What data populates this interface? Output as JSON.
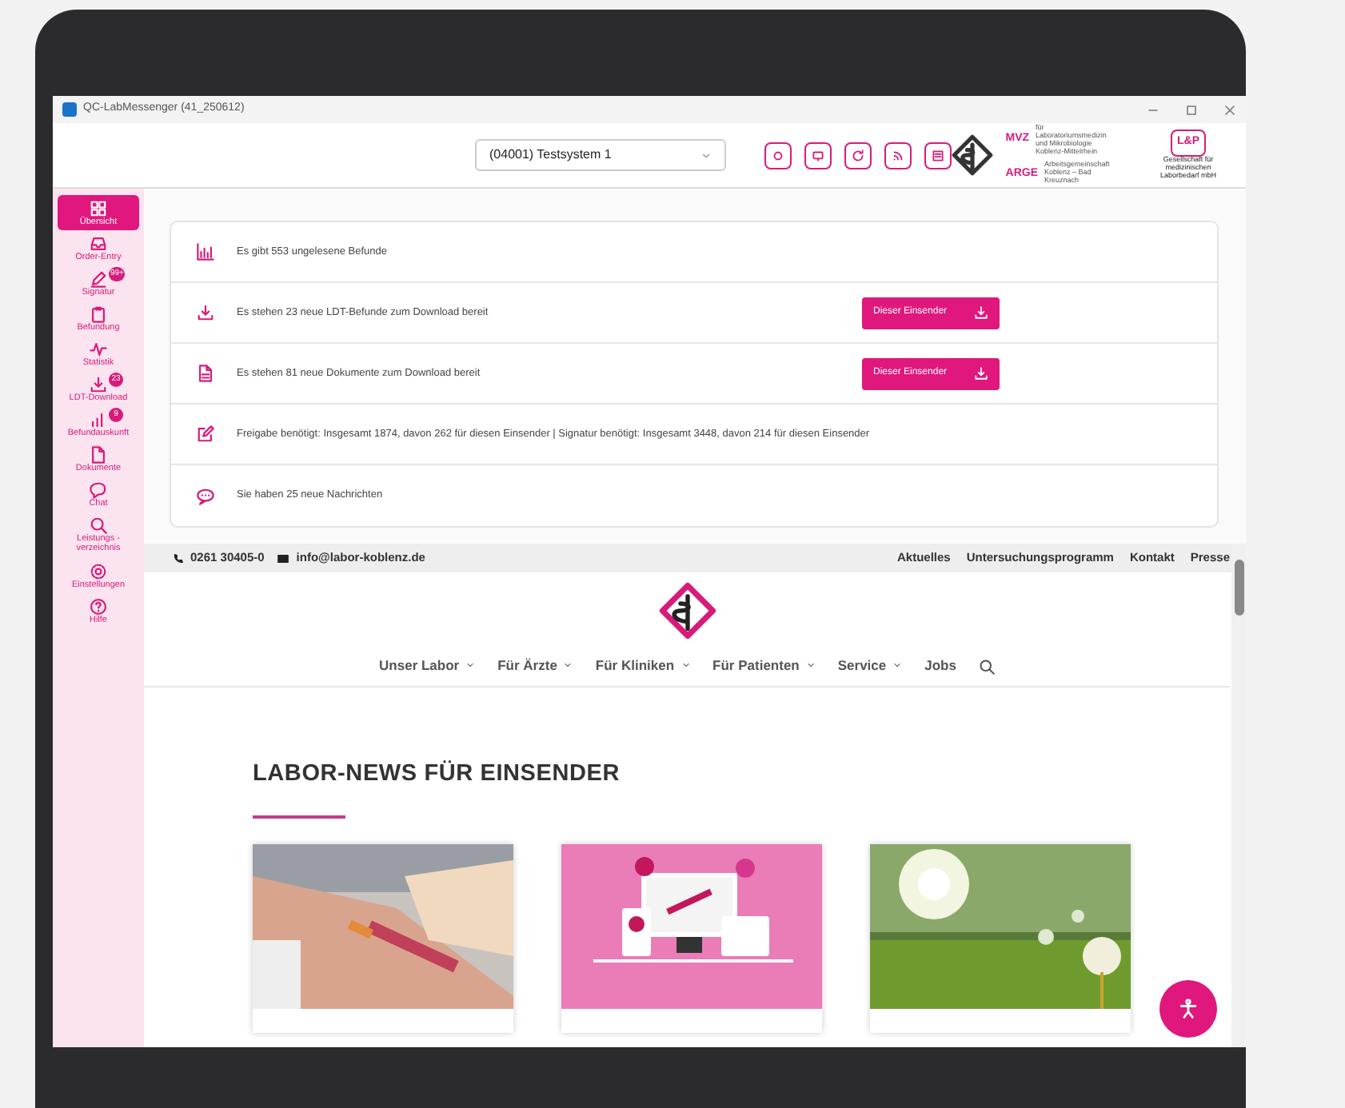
{
  "window": {
    "title": "QC-LabMessenger (41_250612)"
  },
  "header": {
    "system_select": "(04001) Testsystem 1",
    "logos": [
      {
        "title": "MVZ",
        "text": "für Laboratoriumsmedizin und Mikrobiologie Koblenz-Mittelrhein"
      },
      {
        "title": "ARGE",
        "text": "Arbeitsgemeinschaft Koblenz – Bad Kreuznach"
      },
      {
        "title": "L&P",
        "text": "Gesellschaft für medizinischen Laborbedarf mbH"
      }
    ]
  },
  "sidebar": {
    "items": [
      {
        "label": "Übersicht",
        "selected": true
      },
      {
        "label": "Order-Entry",
        "selected": false
      },
      {
        "label": "Signatur",
        "selected": false,
        "badge": "99+"
      },
      {
        "label": "Befundung",
        "selected": false
      },
      {
        "label": "Statistik",
        "selected": false
      },
      {
        "label": "LDT-Download",
        "selected": false,
        "badge": "23"
      },
      {
        "label": "Befundauskunft",
        "selected": false,
        "badge": "9"
      },
      {
        "label": "Dokumente",
        "selected": false
      },
      {
        "label": "Chat",
        "selected": false
      },
      {
        "label": "Leistungs - verzeichnis",
        "selected": false
      },
      {
        "label": "Einstellungen",
        "selected": false
      },
      {
        "label": "Hilfe",
        "selected": false
      }
    ]
  },
  "notifications": [
    {
      "kind": "chart",
      "text": "Es gibt 553 ungelesene Befunde"
    },
    {
      "kind": "download",
      "text": "Es stehen 23 neue LDT-Befunde zum Download bereit",
      "button": "Dieser Einsender"
    },
    {
      "kind": "document",
      "text": "Es stehen 81 neue Dokumente zum Download bereit",
      "button": "Dieser Einsender"
    },
    {
      "kind": "edit",
      "text": "Freigabe benötigt: Insgesamt 1874, davon 262 für diesen Einsender  | Signatur benötigt: Insgesamt 3448, davon 214 für diesen Einsender"
    },
    {
      "kind": "chat",
      "text": "Sie haben 25 neue Nachrichten"
    }
  ],
  "website": {
    "phone": "0261 30405-0",
    "email": "info@labor-koblenz.de",
    "top_links": [
      "Aktuelles",
      "Untersuchungsprogramm",
      "Kontakt",
      "Presse"
    ],
    "nav": [
      {
        "label": "Unser Labor",
        "dropdown": true
      },
      {
        "label": "Für Ärzte",
        "dropdown": true
      },
      {
        "label": "Für Kliniken",
        "dropdown": true
      },
      {
        "label": "Für Patienten",
        "dropdown": true
      },
      {
        "label": "Service",
        "dropdown": true
      },
      {
        "label": "Jobs",
        "dropdown": false
      }
    ],
    "heading": "LABOR-NEWS FÜR EINSENDER",
    "cards": [
      {
        "kind": "picture"
      },
      {
        "kind": "picture"
      },
      {
        "kind": "picture"
      }
    ]
  }
}
